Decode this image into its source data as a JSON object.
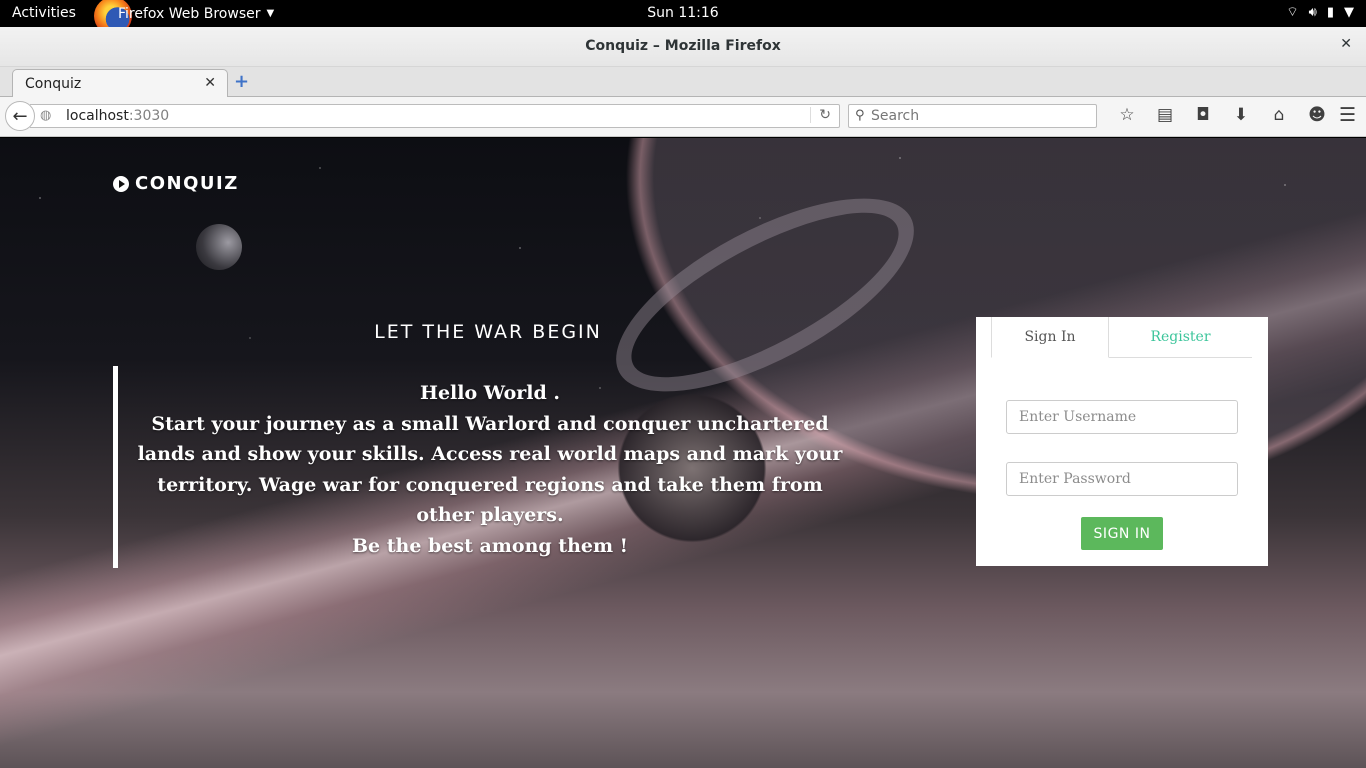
{
  "system": {
    "activities": "Activities",
    "app_name": "Firefox Web Browser",
    "clock": "Sun 11:16",
    "icons": [
      "wifi-icon",
      "volume-icon",
      "battery-icon",
      "power-menu-icon"
    ]
  },
  "window": {
    "title": "Conquiz – Mozilla Firefox"
  },
  "tabs": [
    {
      "label": "Conquiz"
    }
  ],
  "navbar": {
    "url_host": "localhost",
    "url_port": ":3030",
    "search_placeholder": "Search"
  },
  "page": {
    "brand": "CONQUIZ",
    "hero_heading": "LET THE WAR BEGIN",
    "quote_lines": [
      "Hello World .",
      "Start your journey as a small Warlord and conquer unchartered lands and show your skills. Access real world maps and mark your territory. Wage war for conquered regions and take them from other players.",
      "Be the best among them !"
    ]
  },
  "login": {
    "tab_signin": "Sign In",
    "tab_register": "Register",
    "username_placeholder": "Enter Username",
    "password_placeholder": "Enter Password",
    "submit_label": "SIGN IN"
  },
  "colors": {
    "accent_green": "#5cb85c",
    "register_link": "#3cc59b"
  }
}
